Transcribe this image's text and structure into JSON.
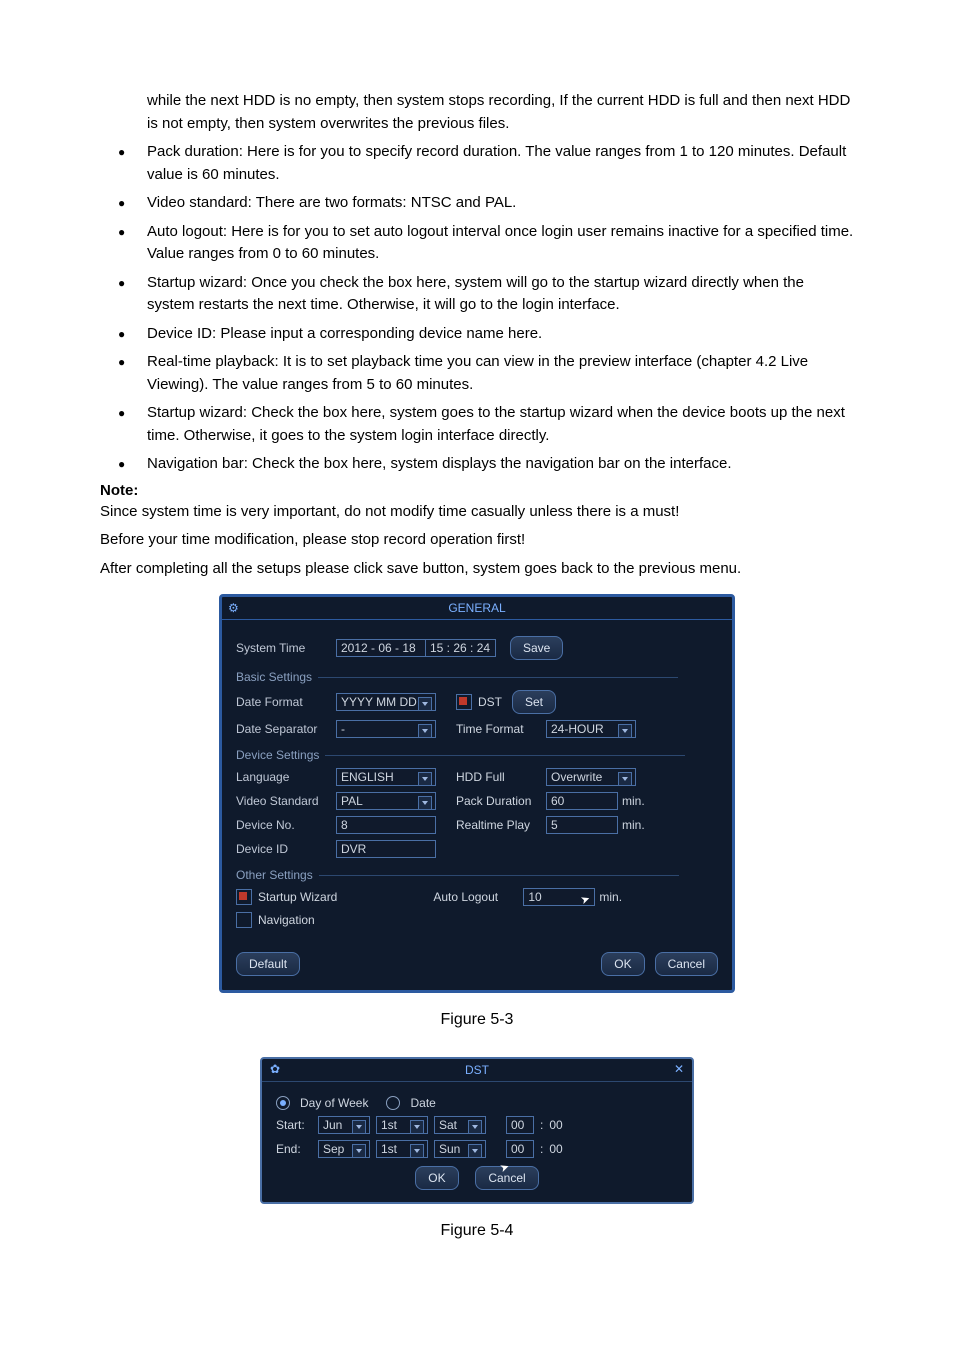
{
  "intro_cont": "while the next HDD is no empty, then system stops recording, If the current HDD is full and then next HDD is not empty, then system overwrites the previous files.",
  "bullets": [
    "Pack duration: Here is for you to specify record duration. The value ranges from 1 to 120 minutes. Default value is 60 minutes.",
    "Video standard: There are two formats: NTSC and PAL.",
    "Auto logout: Here is for you to set auto logout interval once login user remains inactive for a specified time. Value ranges from 0 to 60 minutes.",
    "Startup wizard: Once you check the box here, system will go to the startup wizard directly when the system restarts the next time. Otherwise, it will go to the login interface.",
    "Device ID: Please input a corresponding device name here.",
    "Real-time playback: It is to set playback time you can view in the preview interface (chapter 4.2 Live Viewing). The value ranges from 5 to 60 minutes.",
    "Startup wizard: Check the box here, system goes to the startup wizard when the device boots up the next time. Otherwise, it goes to the system login interface directly.",
    "Navigation bar: Check the box here, system displays the navigation bar on the interface."
  ],
  "note_head": "Note:",
  "note_lines": [
    "Since system time is very important, do not modify time casually unless there is a must!",
    "Before your time modification, please stop record operation first!",
    "After completing all the setups please click save button, system goes back to the previous menu."
  ],
  "general": {
    "title": "GENERAL",
    "labels": {
      "system_time": "System Time",
      "basic_settings": "Basic Settings",
      "date_format": "Date Format",
      "dst": "DST",
      "set": "Set",
      "date_separator": "Date Separator",
      "time_format": "Time Format",
      "device_settings": "Device Settings",
      "language": "Language",
      "hdd_full": "HDD Full",
      "video_standard": "Video Standard",
      "pack_duration": "Pack Duration",
      "device_no": "Device No.",
      "realtime_play": "Realtime Play",
      "device_id": "Device ID",
      "other_settings": "Other Settings",
      "startup_wizard": "Startup Wizard",
      "auto_logout": "Auto Logout",
      "navigation": "Navigation",
      "min": "min.",
      "default": "Default",
      "ok": "OK",
      "cancel": "Cancel",
      "save": "Save"
    },
    "values": {
      "system_date": "2012 - 06 - 18",
      "system_time": "15 : 26 : 24",
      "date_format": "YYYY MM DD",
      "date_separator": "-",
      "time_format": "24-HOUR",
      "language": "ENGLISH",
      "hdd_full": "Overwrite",
      "video_standard": "PAL",
      "pack_duration": "60",
      "device_no": "8",
      "realtime_play": "5",
      "device_id": "DVR",
      "auto_logout": "10"
    }
  },
  "fig1": "Figure 5-3",
  "dst": {
    "title": "DST",
    "dayofweek": "Day of Week",
    "date": "Date",
    "start": "Start:",
    "end": "End:",
    "start_vals": {
      "month": "Jun",
      "week": "1st",
      "day": "Sat",
      "hour": "00",
      "min": "00"
    },
    "end_vals": {
      "month": "Sep",
      "week": "1st",
      "day": "Sun",
      "hour": "00",
      "min": "00"
    },
    "colon": ":",
    "ok": "OK",
    "cancel": "Cancel"
  },
  "fig2": "Figure 5-4"
}
